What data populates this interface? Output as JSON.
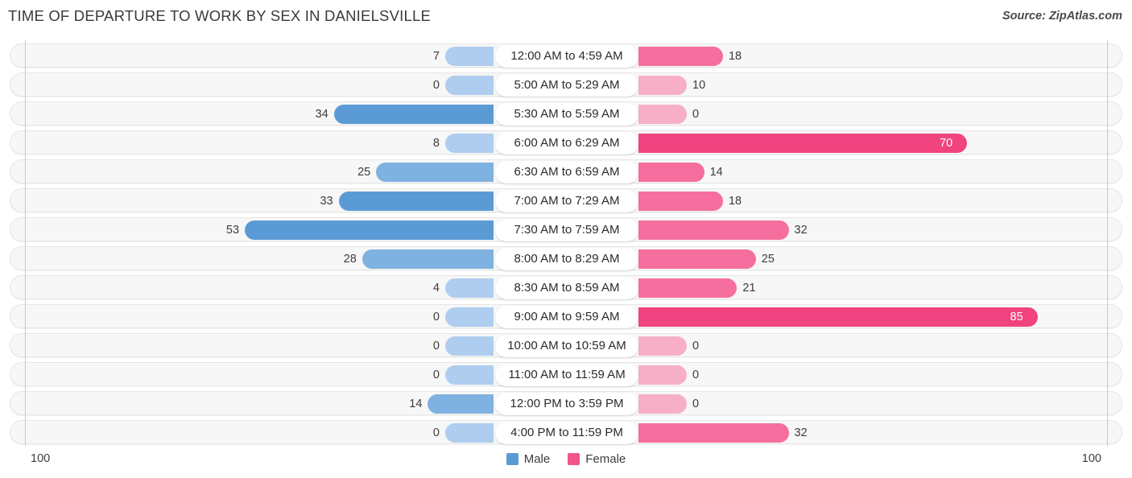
{
  "header": {
    "title": "TIME OF DEPARTURE TO WORK BY SEX IN DANIELSVILLE",
    "source": "Source: ZipAtlas.com"
  },
  "footer": {
    "axis_left": "100",
    "axis_right": "100"
  },
  "legend": {
    "items": [
      {
        "label": "Male",
        "color": "#5B9BD5"
      },
      {
        "label": "Female",
        "color": "#F0558C"
      }
    ]
  },
  "colors": {
    "male_strong": "#5B9BD5",
    "male_mid": "#7FB2E0",
    "male_light": "#AFCDEF",
    "female_strong": "#F0437F",
    "female_mid": "#F56E9E",
    "female_light": "#F7AFC8",
    "track": "#F7F7F7",
    "axis": "#C8C8C8"
  },
  "chart_data": {
    "type": "bar",
    "subtype": "diverging-bidirectional",
    "title": "TIME OF DEPARTURE TO WORK BY SEX IN DANIELSVILLE",
    "xlabel": "",
    "ylabel": "",
    "xlim": [
      100,
      100
    ],
    "axis_max": 100,
    "grid": false,
    "legend_position": "bottom-center",
    "categories": [
      "12:00 AM to 4:59 AM",
      "5:00 AM to 5:29 AM",
      "5:30 AM to 5:59 AM",
      "6:00 AM to 6:29 AM",
      "6:30 AM to 6:59 AM",
      "7:00 AM to 7:29 AM",
      "7:30 AM to 7:59 AM",
      "8:00 AM to 8:29 AM",
      "8:30 AM to 8:59 AM",
      "9:00 AM to 9:59 AM",
      "10:00 AM to 10:59 AM",
      "11:00 AM to 11:59 AM",
      "12:00 PM to 3:59 PM",
      "4:00 PM to 11:59 PM"
    ],
    "series": [
      {
        "name": "Male",
        "color": "#5B9BD5",
        "direction": "left",
        "values": [
          7,
          0,
          34,
          8,
          25,
          33,
          53,
          28,
          4,
          0,
          0,
          0,
          14,
          0
        ]
      },
      {
        "name": "Female",
        "color": "#F0558C",
        "direction": "right",
        "values": [
          18,
          10,
          0,
          70,
          14,
          18,
          32,
          25,
          21,
          85,
          0,
          0,
          0,
          32
        ]
      }
    ]
  }
}
